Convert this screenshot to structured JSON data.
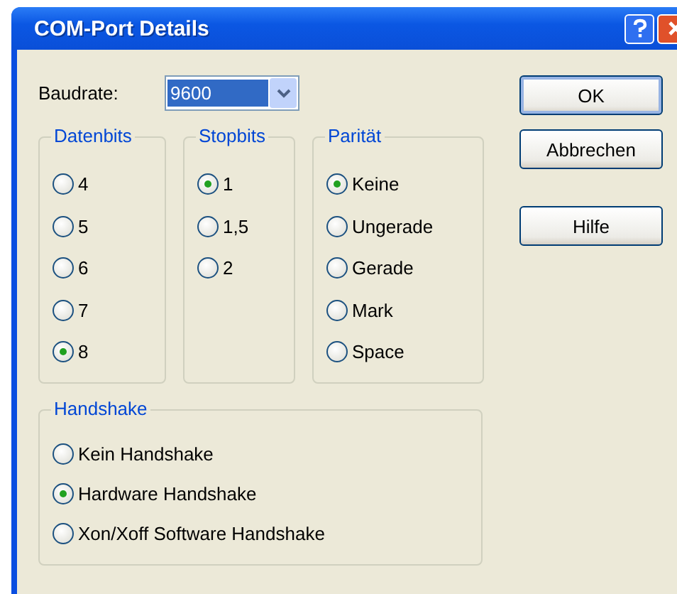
{
  "window": {
    "title": "COM-Port Details"
  },
  "baudrate": {
    "label": "Baudrate:",
    "value": "9600"
  },
  "buttons": [
    "OK",
    "Abbrechen",
    "Hilfe"
  ],
  "groups": [
    {
      "title": "Datenbits",
      "options": [
        {
          "label": "4",
          "selected": false
        },
        {
          "label": "5",
          "selected": false
        },
        {
          "label": "6",
          "selected": false
        },
        {
          "label": "7",
          "selected": false
        },
        {
          "label": "8",
          "selected": true
        }
      ]
    },
    {
      "title": "Stopbits",
      "options": [
        {
          "label": "1",
          "selected": true
        },
        {
          "label": "1,5",
          "selected": false
        },
        {
          "label": "2",
          "selected": false
        }
      ]
    },
    {
      "title": "Parität",
      "options": [
        {
          "label": "Keine",
          "selected": true
        },
        {
          "label": "Ungerade",
          "selected": false
        },
        {
          "label": "Gerade",
          "selected": false
        },
        {
          "label": "Mark",
          "selected": false
        },
        {
          "label": "Space",
          "selected": false
        }
      ]
    }
  ],
  "handshake": {
    "title": "Handshake",
    "options": [
      {
        "label": "Kein Handshake",
        "selected": false
      },
      {
        "label": "Hardware Handshake",
        "selected": true
      },
      {
        "label": "Xon/Xoff Software Handshake",
        "selected": false
      }
    ]
  }
}
